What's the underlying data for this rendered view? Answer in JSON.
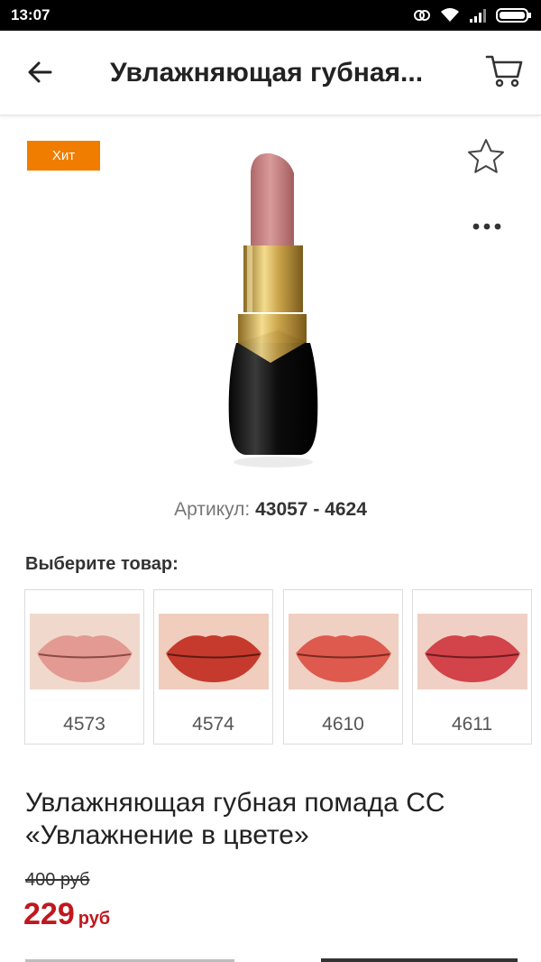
{
  "status_bar": {
    "time": "13:07"
  },
  "header": {
    "title": "Увлажняющая губная...",
    "back_icon": "arrow-left-icon",
    "cart_icon": "cart-icon"
  },
  "product": {
    "badge": "Хит",
    "article_label": "Артикул:",
    "article_value": "43057 - 4624",
    "choose_label": "Выберите товар:",
    "variants": [
      {
        "code": "4573",
        "color": "#e39a93"
      },
      {
        "code": "4574",
        "color": "#c53a2c"
      },
      {
        "code": "4610",
        "color": "#de5a4e"
      },
      {
        "code": "4611",
        "color": "#d2434a"
      }
    ],
    "name": "Увлажняющая губная помада СС «Увлажнение в цвете»",
    "old_price": "400 руб",
    "new_price": "229",
    "new_price_currency": "руб"
  },
  "colors": {
    "badge": "#f07d00",
    "price": "#c0181e",
    "lipstick": "#c98485"
  }
}
